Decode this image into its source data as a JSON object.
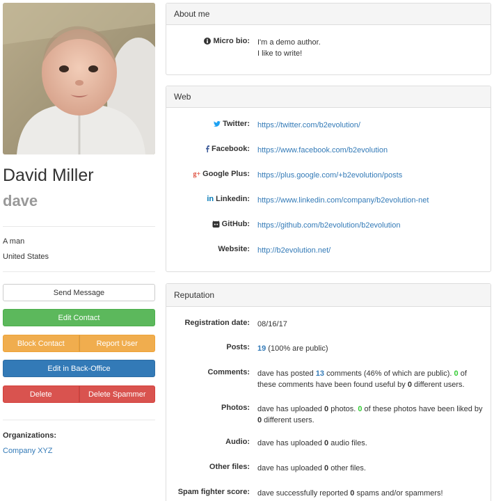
{
  "profile": {
    "full_name": "David Miller",
    "login": "dave",
    "gender": "A man",
    "country": "United States"
  },
  "actions": {
    "send_message": "Send Message",
    "edit_contact": "Edit Contact",
    "block_contact": "Block Contact",
    "report_user": "Report User",
    "edit_backoffice": "Edit in Back-Office",
    "delete": "Delete",
    "delete_spammer": "Delete Spammer"
  },
  "organizations": {
    "title": "Organizations:",
    "items": [
      "Company XYZ"
    ]
  },
  "about": {
    "heading": "About me",
    "bio_label": "Micro bio:",
    "bio_line1": "I'm a demo author.",
    "bio_line2": "I like to write!"
  },
  "web": {
    "heading": "Web",
    "twitter_label": "Twitter:",
    "twitter_url": "https://twitter.com/b2evolution/",
    "facebook_label": "Facebook:",
    "facebook_url": "https://www.facebook.com/b2evolution",
    "googleplus_label": "Google Plus:",
    "googleplus_url": "https://plus.google.com/+b2evolution/posts",
    "linkedin_label": "Linkedin:",
    "linkedin_url": "https://www.linkedin.com/company/b2evolution-net",
    "github_label": "GitHub:",
    "github_url": "https://github.com/b2evolution/b2evolution",
    "website_label": "Website:",
    "website_url": "http://b2evolution.net/"
  },
  "reputation": {
    "heading": "Reputation",
    "reg_label": "Registration date:",
    "reg_value": "08/16/17",
    "posts_label": "Posts:",
    "posts_count": "19",
    "posts_rest": " (100% are public)",
    "comments_label": "Comments:",
    "comments_t1": "dave has posted ",
    "comments_count": "13",
    "comments_t2": " comments (46% of which are public). ",
    "comments_useful": "0",
    "comments_t3": " of these comments have been found useful by ",
    "comments_users": "0",
    "comments_t4": " different users.",
    "photos_label": "Photos:",
    "photos_t1": "dave has uploaded ",
    "photos_count": "0",
    "photos_t2": " photos. ",
    "photos_liked": "0",
    "photos_t3": " of these photos have been liked by ",
    "photos_users": "0",
    "photos_t4": " different users.",
    "audio_label": "Audio:",
    "audio_t1": "dave has uploaded ",
    "audio_count": "0",
    "audio_t2": " audio files.",
    "other_label": "Other files:",
    "other_t1": "dave has uploaded ",
    "other_count": "0",
    "other_t2": " other files.",
    "spam_label": "Spam fighter score:",
    "spam_t1": "dave successfully reported ",
    "spam_count": "0",
    "spam_t2": " spams and/or spammers!"
  },
  "colors": {
    "twitter": "#1da1f2",
    "facebook": "#3b5998",
    "googleplus": "#dd4b39",
    "linkedin": "#0077b5",
    "github": "#333333"
  }
}
